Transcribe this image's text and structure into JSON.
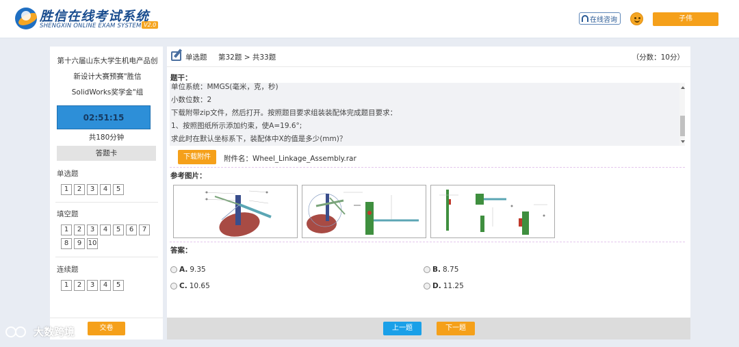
{
  "header": {
    "logo_title": "胜信在线考试系统",
    "logo_subtitle": "SHENGXIN ONLINE EXAM SYSTEM",
    "logo_version": "V2.0",
    "consult_label": "在线咨询",
    "submit_label": "子伟"
  },
  "sidebar": {
    "exam_title": "第十六届山东大学生机电产品创新设计大赛预赛\"胜信SolidWorks奖学金\"组",
    "timer": "02:51:15",
    "total_time": "共180分钟",
    "answer_card": "答题卡",
    "sections": [
      {
        "label": "单选题",
        "items": [
          "1",
          "2",
          "3",
          "4",
          "5"
        ]
      },
      {
        "label": "填空题",
        "items": [
          "1",
          "2",
          "3",
          "4",
          "5",
          "6",
          "7",
          "8",
          "9",
          "10"
        ]
      },
      {
        "label": "连续题",
        "items": [
          "1",
          "2",
          "3",
          "4",
          "5"
        ]
      }
    ],
    "hand_in_label": "交卷"
  },
  "question": {
    "type": "单选题",
    "progress": "第32题 > 共33题",
    "score": "（分数：10分）",
    "stem_label": "题干：",
    "stem_lines": [
      "单位系统：MMGS(毫米，克，秒)",
      "小数位数：2",
      "下载附带zip文件，然后打开。按照题目要求组装装配体完成题目要求：",
      "1、按照图纸所示添加约束，使A=19.6°;",
      "求此时在默认坐标系下，装配体中X的值是多少(mm)？"
    ],
    "download_label": "下载附件",
    "attachment_label": "附件名：Wheel_Linkage_Assembly.rar",
    "ref_label": "参考图片：",
    "answer_label": "答案：",
    "options": [
      {
        "letter": "A.",
        "value": "9.35"
      },
      {
        "letter": "B.",
        "value": "8.75"
      },
      {
        "letter": "C.",
        "value": "10.65"
      },
      {
        "letter": "D.",
        "value": "11.25"
      }
    ]
  },
  "nav": {
    "prev_label": "上一题",
    "next_label": "下一题"
  },
  "watermark": "大数跨境",
  "colors": {
    "brand_blue": "#1a4d8f",
    "accent_orange": "#f5a01a",
    "timer_blue": "#2d8fd8",
    "prev_blue": "#1aa0e8"
  }
}
